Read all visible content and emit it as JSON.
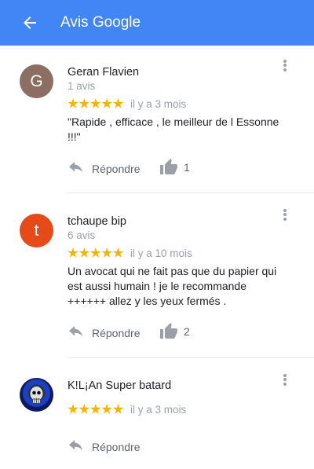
{
  "header": {
    "title": "Avis Google",
    "back_icon": "arrow-left-icon",
    "background": "#4285f4"
  },
  "reviews": [
    {
      "avatar_letter": "G",
      "avatar_color": "#8d6e63",
      "name": "Geran Flavien",
      "review_count": "1 avis",
      "rating": 5,
      "time": "il y a 3 mois",
      "text": "\"Rapide , efficace , le meilleur de l Essonne\n!!!\"",
      "reply_label": "Répondre",
      "likes": "1"
    },
    {
      "avatar_letter": "t",
      "avatar_color": "#e64a19",
      "name": "tchaupe bip",
      "review_count": "6 avis",
      "rating": 5,
      "time": "il y a 10 mois",
      "text": "Un avocat qui ne fait pas que du papier qui\nest aussi humain ! je le recommande\n++++++ allez y les yeux fermés .",
      "reply_label": "Répondre",
      "likes": "2"
    },
    {
      "avatar_letter": "",
      "avatar_color": "#1a237e",
      "name": "K!L¡An Super batard",
      "review_count": "",
      "rating": 5,
      "time": "il y a 3 mois",
      "text": "",
      "reply_label": "Répondre",
      "likes": ""
    }
  ],
  "colors": {
    "star": "#f4b400",
    "secondary_text": "#9aa0a6"
  }
}
